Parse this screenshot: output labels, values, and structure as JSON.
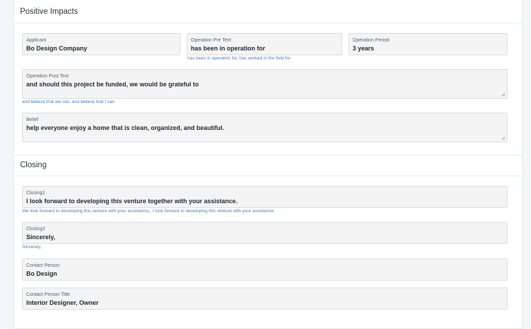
{
  "positive_impacts": {
    "title": "Positive Impacts",
    "applicant": {
      "label": "Applicant",
      "value": "Bo Design Company"
    },
    "operation_pre_text": {
      "label": "Operation Pre Text",
      "value": "has been in operation for",
      "hint": "has been in operation for, has worked in the field for"
    },
    "operation_period": {
      "label": "Operation Period",
      "value": "3 years"
    },
    "operation_post_text": {
      "label": "Operation Post Text",
      "value": "and should this project be funded, we would be grateful to",
      "hint": "and believe that we can, and believe that I can"
    },
    "belief": {
      "label": "Belief",
      "value": "help everyone enjoy a home that is clean, organized, and beautiful."
    }
  },
  "closing": {
    "title": "Closing",
    "closing1": {
      "label": "Closing1",
      "value": "I look forward to developing this venture together with your assistance.",
      "hint": "We look forward to developing this venture with your assistance,, I look forward to developing this venture with your assistance."
    },
    "closing2": {
      "label": "Closing2",
      "value": "Sincerely,",
      "hint": "Sincerely,"
    },
    "contact_person": {
      "label": "Contact Person",
      "value": "Bo Design"
    },
    "contact_person_title": {
      "label": "Contact Person Title",
      "value": "Interior Designer, Owner"
    }
  },
  "colors": {
    "hint_text": "#3d7fc1",
    "field_background": "#f4f4f5",
    "field_border": "#d9dcdf"
  },
  "icons": {
    "textarea_resize": "resize-grip-icon"
  }
}
